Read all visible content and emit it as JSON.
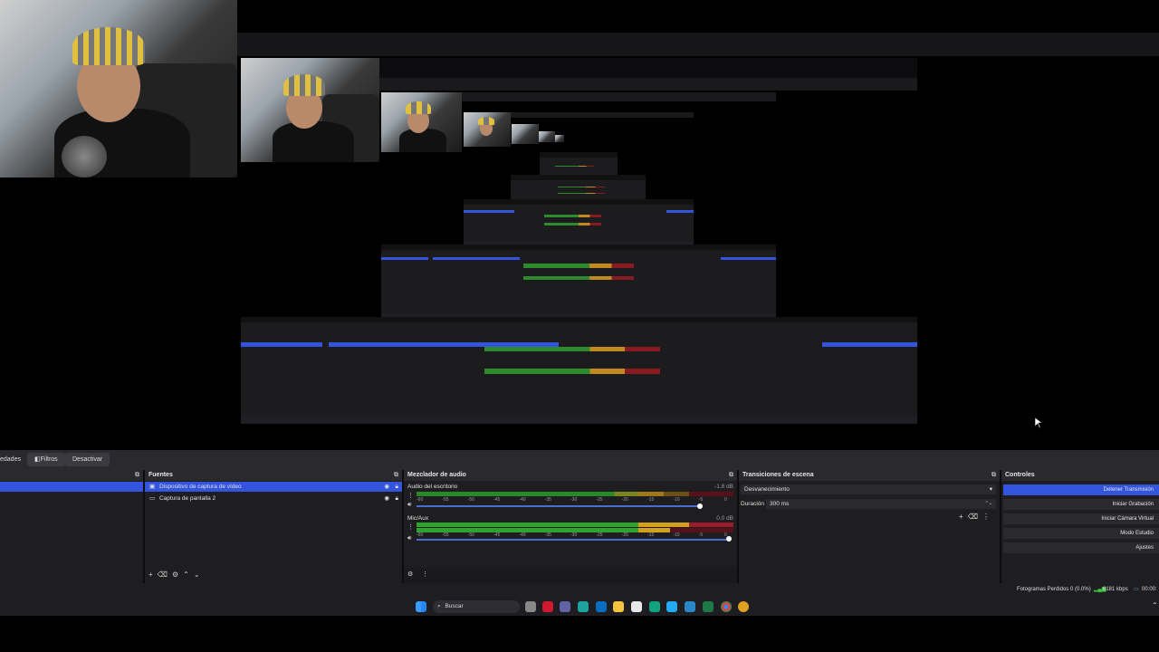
{
  "tabs": {
    "propiedades": "edades",
    "filtros": "Filtros",
    "desactivar": "Desactivar"
  },
  "fuentes": {
    "title": "Fuentes",
    "items": [
      {
        "label": "Dispositivo de captura de vídeo",
        "selected": true
      },
      {
        "label": "Captura de pantalla 2",
        "selected": false
      }
    ]
  },
  "mixer": {
    "title": "Mezclador de audio",
    "channels": [
      {
        "name": "Audio del escritorio",
        "db": "-1.8 dB",
        "level": 0.78
      },
      {
        "name": "Mic/Aux",
        "db": "0.0 dB",
        "level": 0.86
      }
    ],
    "ticks": [
      "-60",
      "-55",
      "-50",
      "-45",
      "-40",
      "-35",
      "-30",
      "-25",
      "-20",
      "-15",
      "-10",
      "-5",
      "0"
    ]
  },
  "transitions": {
    "title": "Transiciones de escena",
    "selected": "Desvanecimiento",
    "duration_label": "Duración",
    "duration_value": "300 ms"
  },
  "controls": {
    "title": "Controles",
    "buttons": [
      "Detener Transmisión",
      "Iniciar Grabación",
      "Iniciar Cámara Virtual",
      "Modo Estudio",
      "Ajustes"
    ]
  },
  "status": {
    "frames": "Fotogramas Perdidos 0 (0.0%)",
    "bitrate": "6181 kbps",
    "time": "00:00:"
  },
  "taskbar": {
    "search": "Buscar"
  },
  "colors": {
    "accent": "#3355dd",
    "green": "#3ec43e",
    "yellow": "#d4a020",
    "red": "#9a1c28"
  }
}
